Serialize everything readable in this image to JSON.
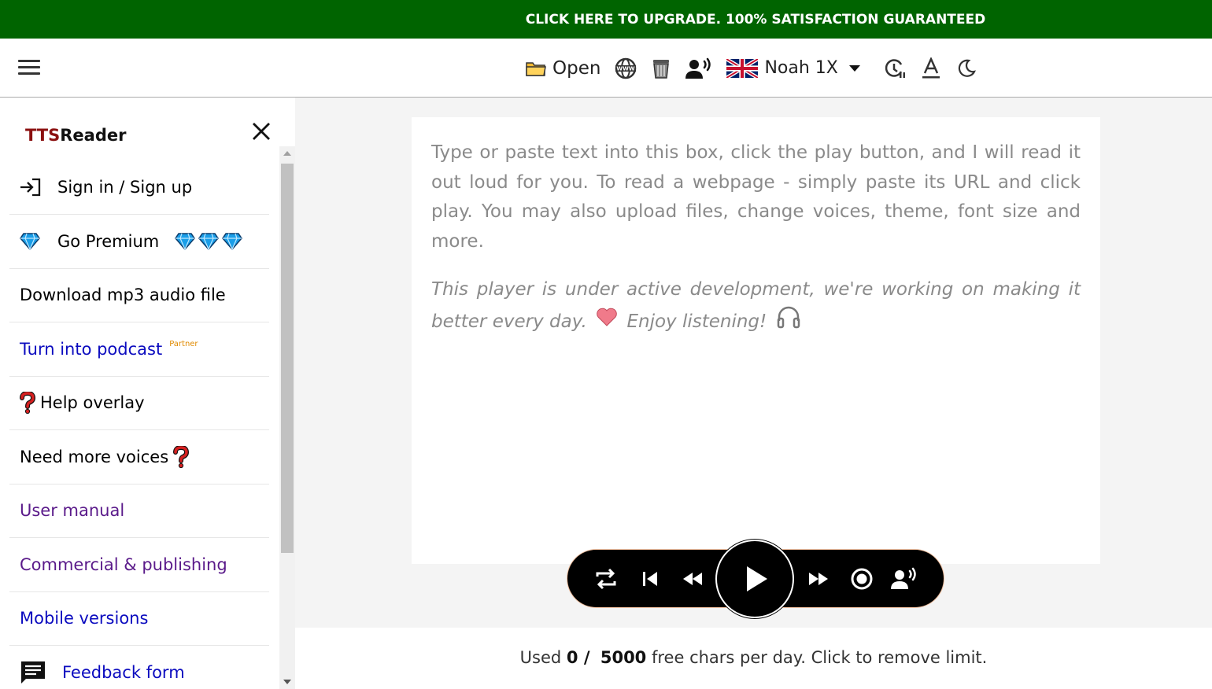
{
  "banner": {
    "text": "CLICK HERE TO UPGRADE. 100% SATISFACTION GUARANTEED"
  },
  "toolbar": {
    "open_label": "Open",
    "voice_label": "Noah 1X",
    "icons": [
      "menu-icon",
      "folder-icon",
      "www-globe-icon",
      "trash-icon",
      "speaker-person-icon",
      "uk-flag-icon",
      "chevron-down-icon",
      "timer-icon",
      "font-icon",
      "moon-icon"
    ]
  },
  "sidebar": {
    "brand_tts": "TTS",
    "brand_reader": "Reader",
    "items": [
      {
        "label": "Sign in / Sign up"
      },
      {
        "label": "Go Premium"
      },
      {
        "label": "Download mp3 audio file"
      },
      {
        "label": "Turn into podcast",
        "badge": "Partner"
      },
      {
        "label": "Help overlay"
      },
      {
        "label": "Need more voices"
      },
      {
        "label": "User manual"
      },
      {
        "label": "Commercial & publishing"
      },
      {
        "label": "Mobile versions"
      },
      {
        "label": "Feedback form"
      }
    ]
  },
  "editor": {
    "placeholder_line1": "Type or paste text into this box, click the play button, and I will read it out loud for you. To read a webpage - simply paste its URL and click play. You may also upload files, change voices, theme, font size and more.",
    "placeholder_line2a": "This player is under active development, we're working on making it better every day.",
    "placeholder_line2b": "Enjoy listening!"
  },
  "usage": {
    "prefix": "Used",
    "used": "0 /",
    "limit": "5000",
    "suffix": "free chars per day. Click to remove limit."
  },
  "colors": {
    "banner": "#006400",
    "brand_tts": "#8b1010",
    "link_blue": "#0b0bbf",
    "link_purple": "#5a1a8a",
    "partner": "#e08a00"
  }
}
